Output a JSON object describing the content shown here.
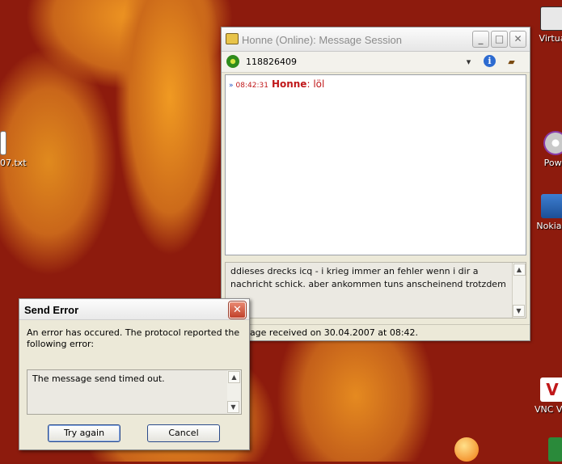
{
  "desktop": {
    "icons": [
      {
        "label": "Virtua",
        "icon": "computer-shortcut-icon"
      },
      {
        "label": "07.txt",
        "icon": "text-file-icon"
      },
      {
        "label": "Powe",
        "icon": "disc-shortcut-icon"
      },
      {
        "label": "Nokia P",
        "icon": "nokia-shortcut-icon"
      },
      {
        "label": "VNC Vie",
        "icon": "vnc-shortcut-icon"
      }
    ]
  },
  "message_window": {
    "title": "Honne (Online): Message Session",
    "uin": "118826409",
    "history": [
      {
        "time": "08:42:31",
        "nick": "Honne",
        "separator": ":",
        "text": "löl"
      }
    ],
    "compose_text": "ddieses drecks icq - i krieg immer an fehler wenn i dir a nachricht schick. aber ankommen tuns anscheinend trotzdem",
    "status_text": "message received on 30.04.2007 at 08:42.",
    "title_buttons": {
      "minimize": "_",
      "maximize": "□",
      "close": "✕"
    }
  },
  "error_dialog": {
    "title": "Send Error",
    "description": "An error has occured. The protocol reported the following error:",
    "error_text": "The message send timed out.",
    "buttons": {
      "retry": "Try again",
      "cancel": "Cancel"
    },
    "close_glyph": "✕"
  },
  "colors": {
    "accent_red": "#c0181a",
    "dialog_bg": "#ece9d8",
    "wallpaper": "#8d1b0d"
  }
}
